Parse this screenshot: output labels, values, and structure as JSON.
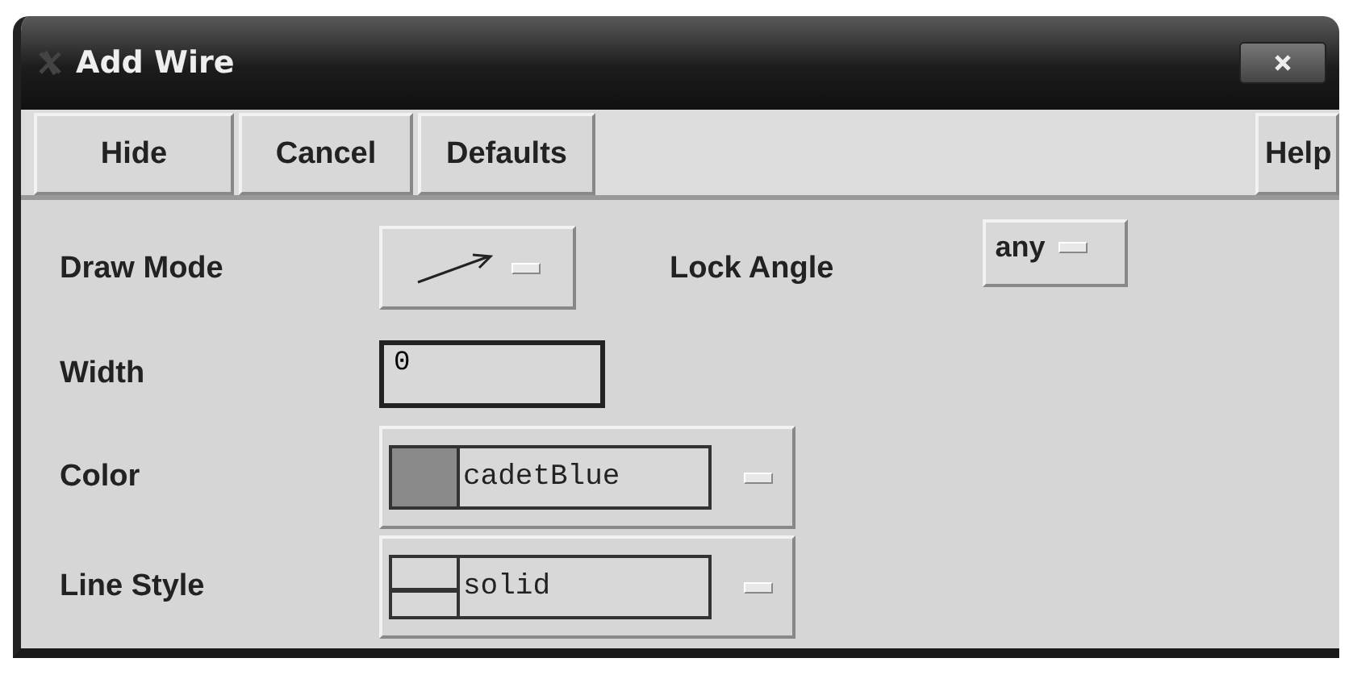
{
  "window": {
    "title": "Add Wire"
  },
  "toolbar": {
    "left": [
      "Hide",
      "Cancel",
      "Defaults"
    ],
    "right": [
      "Help"
    ]
  },
  "rows": [
    {
      "kind": "mode-menu",
      "label": "Draw Mode",
      "extra": {
        "label": "Lock Angle",
        "value": "any"
      }
    },
    {
      "kind": "field",
      "label": "Width",
      "value": "0"
    },
    {
      "kind": "color-menu",
      "label": "Color",
      "value": "cadetBlue"
    },
    {
      "kind": "style-menu",
      "label": "Line Style",
      "value": "solid"
    }
  ]
}
